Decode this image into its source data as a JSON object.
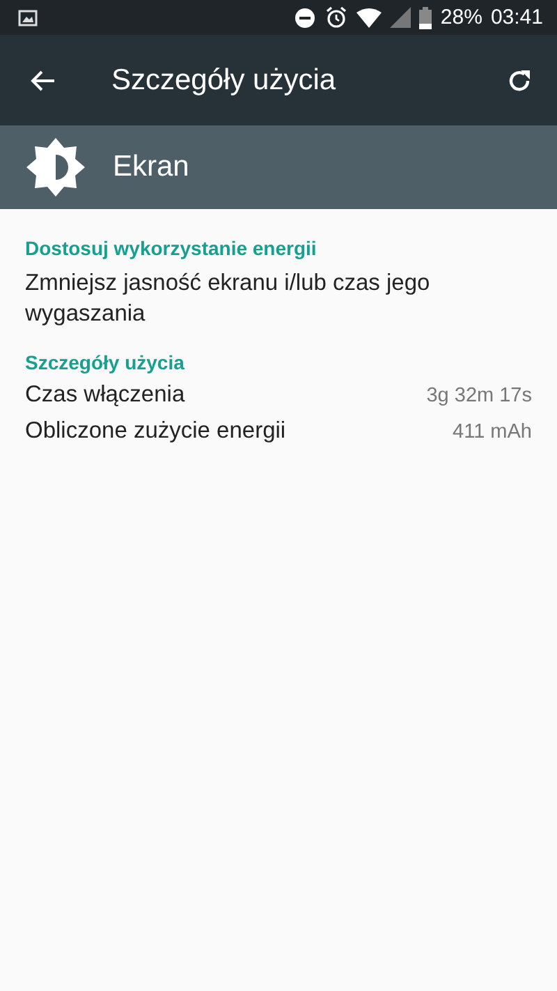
{
  "status_bar": {
    "battery_percent": "28%",
    "time": "03:41"
  },
  "toolbar": {
    "title": "Szczegóły użycia"
  },
  "app_header": {
    "name": "Ekran"
  },
  "sections": [
    {
      "title": "Dostosuj wykorzystanie energii",
      "items": [
        {
          "kind": "text",
          "label": "Zmniejsz jasność ekranu i/lub czas jego wygaszania"
        }
      ]
    },
    {
      "title": "Szczegóły użycia",
      "items": [
        {
          "kind": "detail",
          "label": "Czas włączenia",
          "value": "3g 32m 17s"
        },
        {
          "kind": "detail",
          "label": "Obliczone zużycie energii",
          "value": "411 mAh"
        }
      ]
    }
  ]
}
